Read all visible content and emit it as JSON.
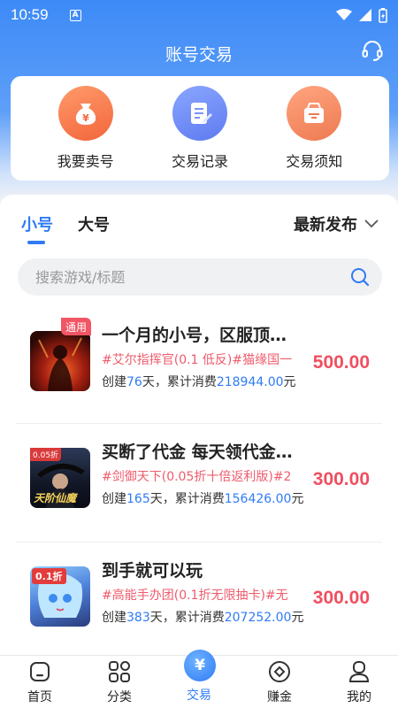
{
  "status_bar": {
    "time": "10:59",
    "notif_letter": "A"
  },
  "header": {
    "title": "账号交易"
  },
  "quick_actions": [
    {
      "label": "我要卖号",
      "icon": "moneybag-icon",
      "color": "#f5764a"
    },
    {
      "label": "交易记录",
      "icon": "document-edit-icon",
      "color": "#6f8cf6"
    },
    {
      "label": "交易须知",
      "icon": "notice-box-icon",
      "color": "#f28b64"
    }
  ],
  "tabs": {
    "small": "小号",
    "big": "大号",
    "sort_label": "最新发布"
  },
  "search": {
    "placeholder": "搜索游戏/标题"
  },
  "listings": [
    {
      "title": "一个月的小号，区服顶…",
      "tags": "#艾尔指挥官(0.1 低反)#猫缘国一",
      "created_prefix": "创建",
      "days": "76",
      "days_suffix": "天，累计消费",
      "spent": "218944.00",
      "unit": "元",
      "price": "500.00",
      "badge": "通用"
    },
    {
      "title": "买断了代金 每天领代金…",
      "tags": "#剑御天下(0.05折十倍返利版)#2",
      "created_prefix": "创建",
      "days": "165",
      "days_suffix": "天，累计消费",
      "spent": "156426.00",
      "unit": "元",
      "price": "300.00",
      "game_text": "天阶仙魔",
      "corner": "0.05折"
    },
    {
      "title": "到手就可以玩",
      "tags": "#高能手办团(0.1折无限抽卡)#无",
      "created_prefix": "创建",
      "days": "383",
      "days_suffix": "天，累计消费",
      "spent": "207252.00",
      "unit": "元",
      "price": "300.00",
      "corner": "0.1折"
    }
  ],
  "bottom_nav": [
    {
      "label": "首页",
      "icon": "home-icon"
    },
    {
      "label": "分类",
      "icon": "category-icon"
    },
    {
      "label": "交易",
      "icon": "trade-yen-icon",
      "active": true,
      "glyph": "¥"
    },
    {
      "label": "赚金",
      "icon": "earn-coin-icon"
    },
    {
      "label": "我的",
      "icon": "profile-icon"
    }
  ],
  "colors": {
    "accent": "#2f7bf5",
    "price": "#ef4f60",
    "tag": "#ef5b6c"
  }
}
